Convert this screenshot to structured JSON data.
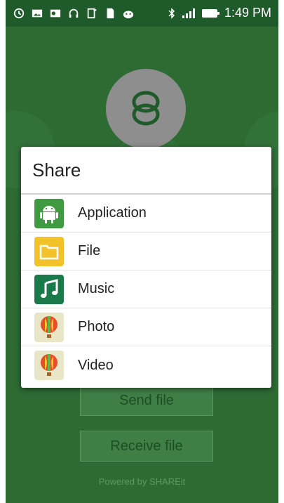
{
  "status_bar": {
    "time": "1:49 PM"
  },
  "dialog": {
    "title": "Share",
    "items": [
      {
        "label": "Application",
        "icon": "android-app-icon"
      },
      {
        "label": "File",
        "icon": "folder-icon"
      },
      {
        "label": "Music",
        "icon": "music-note-icon"
      },
      {
        "label": "Photo",
        "icon": "balloon-photo-icon"
      },
      {
        "label": "Video",
        "icon": "balloon-video-icon"
      }
    ]
  },
  "buttons": {
    "send": "Send file",
    "receive": "Receive file"
  },
  "footer": {
    "powered_by": "Powered by SHAREit"
  },
  "colors": {
    "background": "#2d6b33",
    "status_bar": "#1f5a2a",
    "logo_circle": "#8e8e8e"
  }
}
